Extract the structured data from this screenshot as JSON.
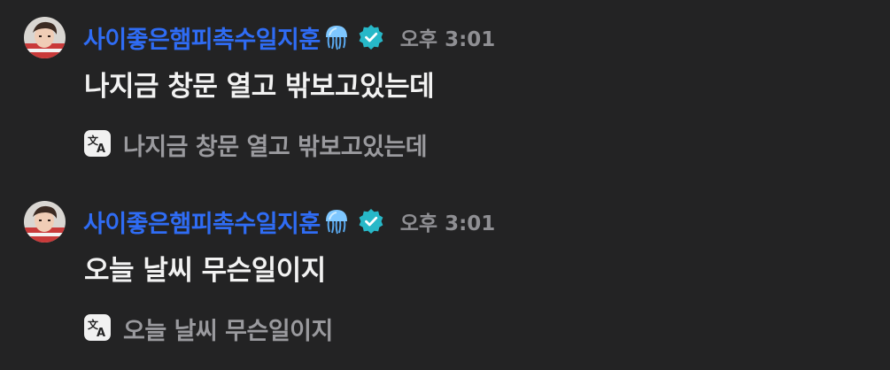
{
  "colors": {
    "background": "#232324",
    "username": "#2f6cf4",
    "verified_badge": "#27b8c8",
    "message_text": "#f2f2f2",
    "muted_text": "#8f8f93"
  },
  "messages": [
    {
      "username": "사이좋은햄피촉수일지훈",
      "username_emoji": "jellyfish-icon",
      "badge": "verified-icon",
      "timestamp": "오후 3:01",
      "text": "나지금 창문 열고 밖보고있는데",
      "translation_icon": "translate-icon",
      "translation": "나지금 창문 열고 밖보고있는데"
    },
    {
      "username": "사이좋은햄피촉수일지훈",
      "username_emoji": "jellyfish-icon",
      "badge": "verified-icon",
      "timestamp": "오후 3:01",
      "text": "오늘 날씨 무슨일이지",
      "translation_icon": "translate-icon",
      "translation": "오늘 날씨 무슨일이지"
    }
  ]
}
